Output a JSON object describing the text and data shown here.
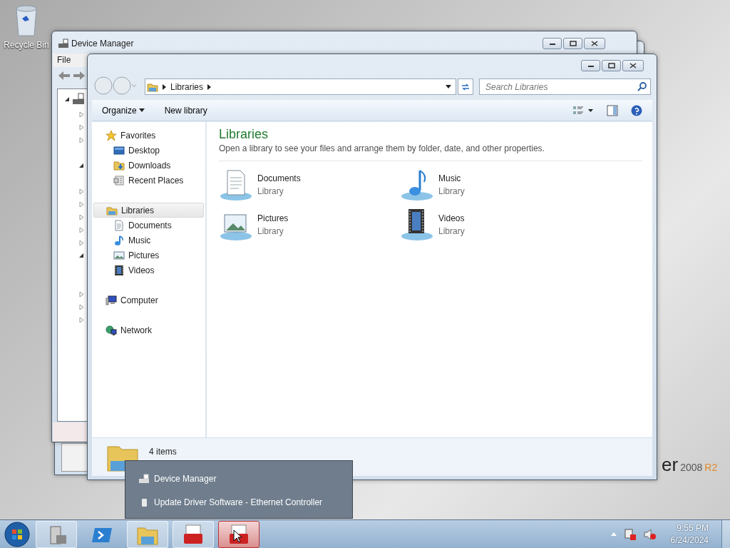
{
  "desktop": {
    "icons": [
      {
        "label": "Recycle Bin"
      }
    ],
    "wallpaper": {
      "product": "er",
      "version": "2008",
      "edition": "R2"
    }
  },
  "device_manager": {
    "title": "Device Manager",
    "menu": [
      "File"
    ],
    "tree": {
      "expanded": true,
      "children": [
        {
          "expanded": false
        },
        {
          "expanded": false
        },
        {
          "expanded": false
        },
        {
          "expanded": true
        },
        {
          "expanded": false
        },
        {
          "expanded": false
        },
        {
          "expanded": false
        },
        {
          "expanded": false
        },
        {
          "expanded": false
        },
        {
          "expanded": true
        },
        {
          "expanded": false
        },
        {
          "expanded": false
        },
        {
          "expanded": false
        }
      ]
    }
  },
  "explorer": {
    "address": [
      "Libraries"
    ],
    "search": {
      "placeholder": "Search Libraries"
    },
    "commands": [
      {
        "label": "Organize",
        "dropdown": true
      },
      {
        "label": "New library",
        "dropdown": false
      }
    ],
    "nav": [
      {
        "label": "Favorites",
        "selected": false,
        "children": [
          {
            "label": "Desktop",
            "selected": false
          },
          {
            "label": "Downloads",
            "selected": false
          },
          {
            "label": "Recent Places",
            "selected": false
          }
        ]
      },
      {
        "label": "Libraries",
        "selected": true,
        "children": [
          {
            "label": "Documents",
            "selected": false
          },
          {
            "label": "Music",
            "selected": false
          },
          {
            "label": "Pictures",
            "selected": false
          },
          {
            "label": "Videos",
            "selected": false
          }
        ]
      },
      {
        "label": "Computer",
        "selected": false
      },
      {
        "label": "Network",
        "selected": false
      }
    ],
    "heading": "Libraries",
    "description": "Open a library to see your files and arrange them by folder, date, and other properties.",
    "libraries": [
      {
        "name": "Documents",
        "type": "Library"
      },
      {
        "name": "Music",
        "type": "Library"
      },
      {
        "name": "Pictures",
        "type": "Library"
      },
      {
        "name": "Videos",
        "type": "Library"
      }
    ],
    "status": "4 items"
  },
  "jump_list": {
    "items": [
      "Device Manager",
      "Update Driver Software - Ethernet Controller"
    ]
  },
  "taskbar": {
    "buttons": [
      {
        "selected": false
      },
      {
        "selected": false
      },
      {
        "selected": false
      },
      {
        "selected": false
      },
      {
        "selected": true
      }
    ],
    "clock": {
      "time": "9:55 PM",
      "date": "6/24/2024"
    }
  }
}
